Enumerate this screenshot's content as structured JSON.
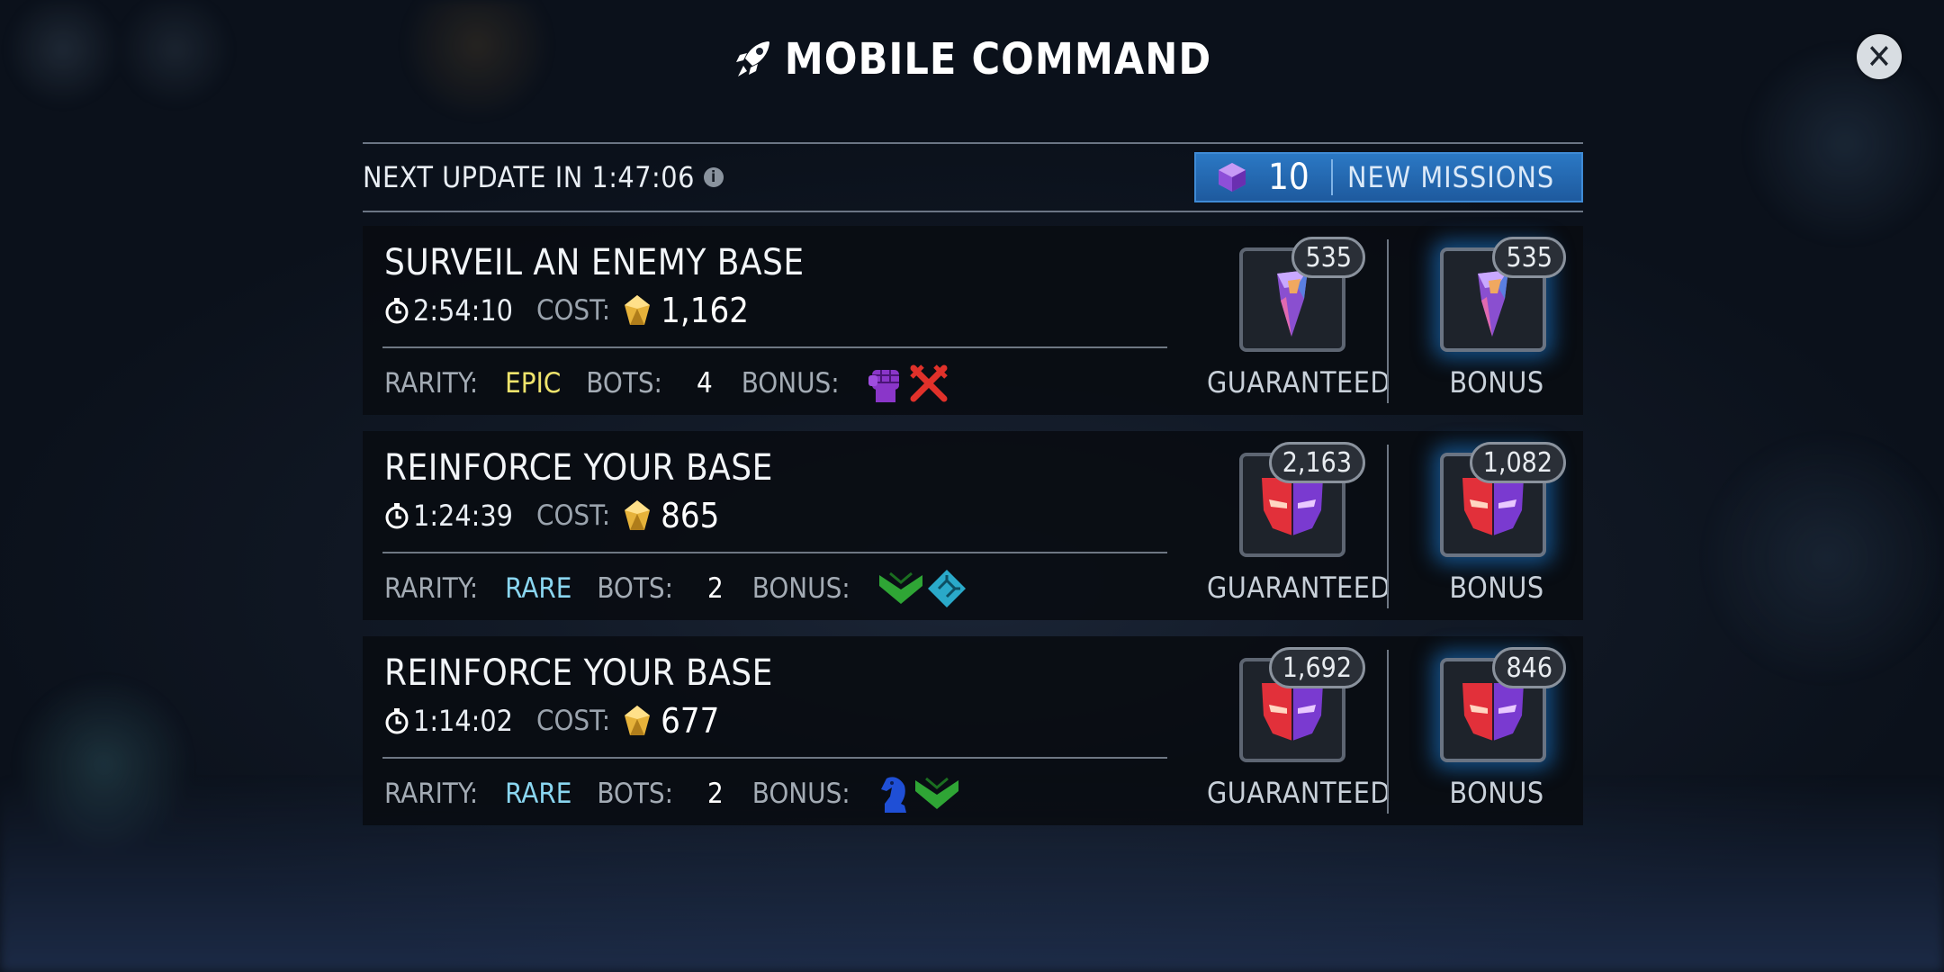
{
  "title": "MOBILE COMMAND",
  "header": {
    "next_update": "NEXT UPDATE IN 1:47:06",
    "new_missions_count": "10",
    "new_missions_label": "NEW MISSIONS"
  },
  "labels": {
    "cost": "COST:",
    "rarity": "RARITY:",
    "bots": "BOTS:",
    "bonus": "BONUS:",
    "guaranteed": "GUARANTEED",
    "bonus_reward": "BONUS"
  },
  "missions": [
    {
      "title": "SURVEIL AN ENEMY BASE",
      "time": "2:54:10",
      "cost": "1,162",
      "rarity": "EPIC",
      "bots": "4",
      "bonus_icons": [
        "purple-fist-icon",
        "red-crossed-swords-icon"
      ],
      "reward_icon": "crystal-shard-icon",
      "guaranteed": "535",
      "bonus": "535"
    },
    {
      "title": "REINFORCE YOUR BASE",
      "time": "1:24:39",
      "cost": "865",
      "rarity": "RARE",
      "bots": "2",
      "bonus_icons": [
        "green-chevron-icon",
        "blue-circuit-icon"
      ],
      "reward_icon": "faction-mask-icon",
      "guaranteed": "2,163",
      "bonus": "1,082"
    },
    {
      "title": "REINFORCE YOUR BASE",
      "time": "1:14:02",
      "cost": "677",
      "rarity": "RARE",
      "bots": "2",
      "bonus_icons": [
        "blue-knight-icon",
        "green-chevron-icon"
      ],
      "reward_icon": "faction-mask-icon",
      "guaranteed": "1,692",
      "bonus": "846"
    }
  ],
  "colors": {
    "epic": "#efe46c",
    "rare": "#8ad6f0",
    "accent": "#2b78c4"
  }
}
